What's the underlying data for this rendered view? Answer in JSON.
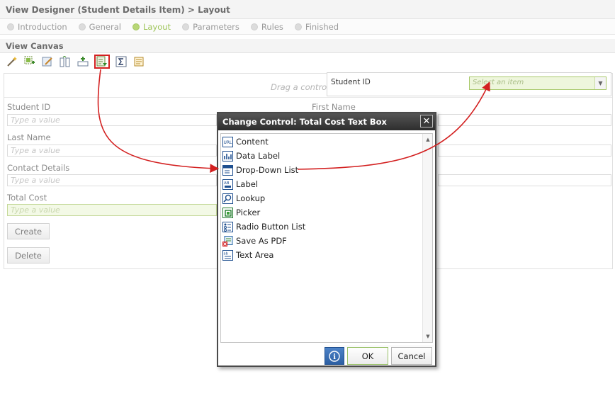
{
  "title": "View Designer (Student Details Item) > Layout",
  "steps": [
    "Introduction",
    "General",
    "Layout",
    "Parameters",
    "Rules",
    "Finished"
  ],
  "canvas_title": "View Canvas",
  "toolbar_icons": [
    "wand-icon",
    "add-control-icon",
    "edit-icon",
    "split-icon",
    "insert-row-icon",
    "change-control-icon",
    "sum-icon",
    "properties-icon"
  ],
  "drag_text": "Drag a contro",
  "popup": {
    "label": "Student ID",
    "select_placeholder": "Select an item",
    "select_arrow": "▼"
  },
  "form": {
    "student_id_label": "Student ID",
    "first_name_label": "First Name",
    "last_name_label": "Last Name",
    "contact_details_label": "Contact Details",
    "total_cost_label": "Total Cost",
    "placeholder": "Type a value",
    "create_label": "Create",
    "delete_label": "Delete"
  },
  "dialog": {
    "title": "Change Control: Total Cost Text Box",
    "close_glyph": "✕",
    "items": [
      {
        "label": "Content",
        "icon": "url-icon"
      },
      {
        "label": "Data Label",
        "icon": "data-label-icon"
      },
      {
        "label": "Drop-Down List",
        "icon": "dropdown-list-icon"
      },
      {
        "label": "Label",
        "icon": "label-icon"
      },
      {
        "label": "Lookup",
        "icon": "lookup-icon"
      },
      {
        "label": "Picker",
        "icon": "picker-icon"
      },
      {
        "label": "Radio Button List",
        "icon": "radio-list-icon"
      },
      {
        "label": "Save As PDF",
        "icon": "pdf-icon"
      },
      {
        "label": "Text Area",
        "icon": "text-area-icon"
      }
    ],
    "scroll_up": "▲",
    "scroll_down": "▼",
    "info_glyph": "i",
    "ok_label": "OK",
    "cancel_label": "Cancel"
  },
  "colors": {
    "accent_green": "#9fc55a",
    "annotation_red": "#d32020",
    "dialog_title": "#2d2d2d"
  }
}
